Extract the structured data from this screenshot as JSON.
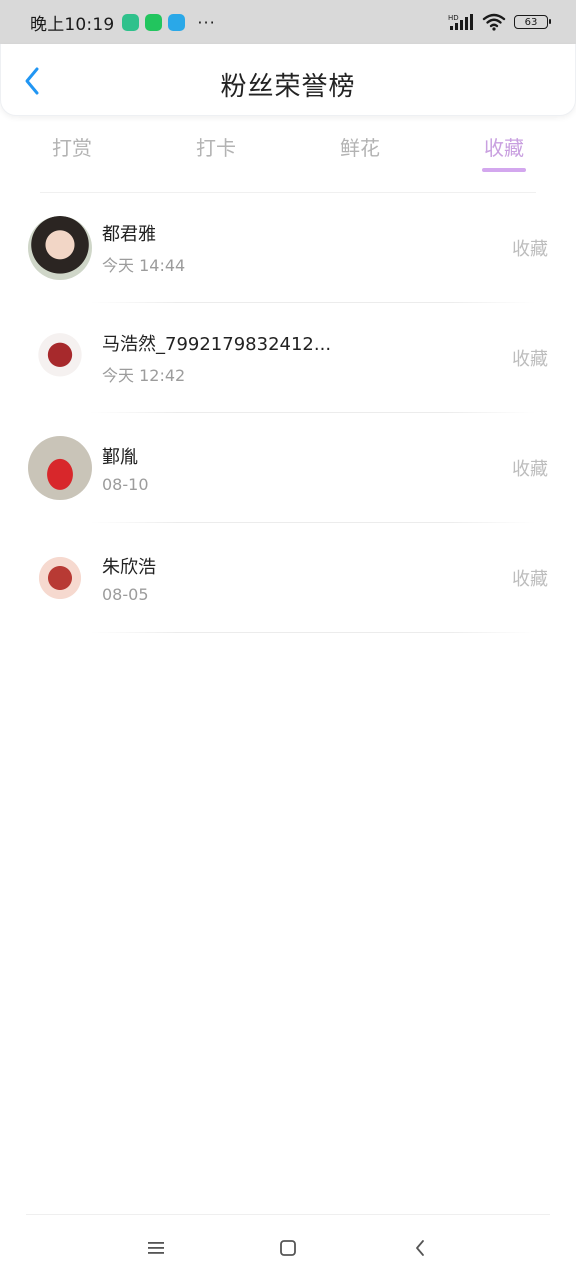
{
  "status_bar": {
    "time": "晚上10:19",
    "more": "···",
    "battery": "63",
    "icons": [
      "qq-icon",
      "wechat-icon",
      "message-icon",
      "hd-signal-icon",
      "wifi-icon",
      "battery-icon"
    ]
  },
  "header": {
    "title": "粉丝荣誉榜",
    "back_icon": "chevron-left-icon"
  },
  "tabs": [
    {
      "label": "打赏",
      "active": false
    },
    {
      "label": "打卡",
      "active": false
    },
    {
      "label": "鲜花",
      "active": false
    },
    {
      "label": "收藏",
      "active": true
    }
  ],
  "fans": [
    {
      "name": "都君雅",
      "time": "今天 14:44",
      "action": "收藏"
    },
    {
      "name": "马浩然_7992179832412...",
      "time": "今天 12:42",
      "action": "收藏"
    },
    {
      "name": "鄞胤",
      "time": "08-10",
      "action": "收藏"
    },
    {
      "name": "朱欣浩",
      "time": "08-05",
      "action": "收藏"
    }
  ],
  "nav_bar": {
    "icons": [
      "menu-icon",
      "home-icon",
      "back-icon"
    ]
  },
  "colors": {
    "accent": "#c9a0e0",
    "back_arrow": "#2196f3",
    "status_bar_bg": "#d9d9d9"
  }
}
